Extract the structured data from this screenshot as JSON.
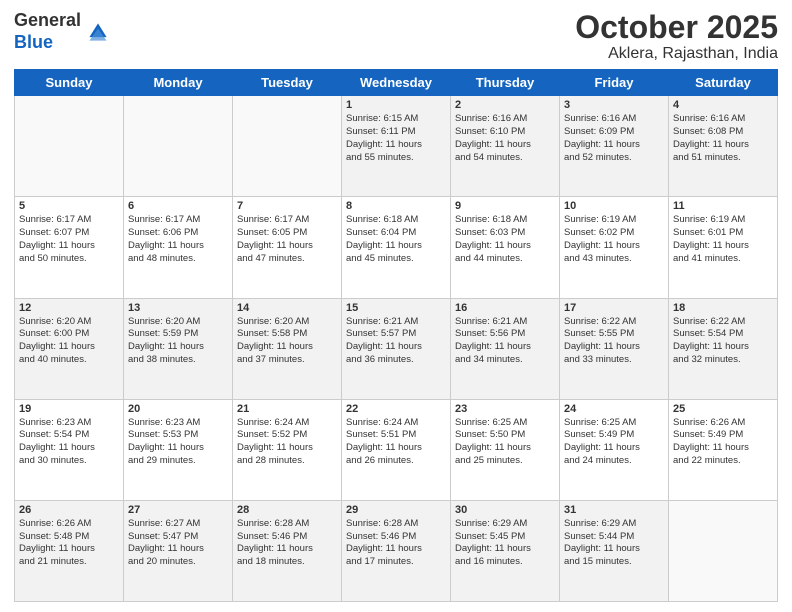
{
  "header": {
    "logo_general": "General",
    "logo_blue": "Blue",
    "month": "October 2025",
    "location": "Aklera, Rajasthan, India"
  },
  "days_of_week": [
    "Sunday",
    "Monday",
    "Tuesday",
    "Wednesday",
    "Thursday",
    "Friday",
    "Saturday"
  ],
  "weeks": [
    [
      {
        "day": "",
        "info": ""
      },
      {
        "day": "",
        "info": ""
      },
      {
        "day": "",
        "info": ""
      },
      {
        "day": "1",
        "info": "Sunrise: 6:15 AM\nSunset: 6:11 PM\nDaylight: 11 hours\nand 55 minutes."
      },
      {
        "day": "2",
        "info": "Sunrise: 6:16 AM\nSunset: 6:10 PM\nDaylight: 11 hours\nand 54 minutes."
      },
      {
        "day": "3",
        "info": "Sunrise: 6:16 AM\nSunset: 6:09 PM\nDaylight: 11 hours\nand 52 minutes."
      },
      {
        "day": "4",
        "info": "Sunrise: 6:16 AM\nSunset: 6:08 PM\nDaylight: 11 hours\nand 51 minutes."
      }
    ],
    [
      {
        "day": "5",
        "info": "Sunrise: 6:17 AM\nSunset: 6:07 PM\nDaylight: 11 hours\nand 50 minutes."
      },
      {
        "day": "6",
        "info": "Sunrise: 6:17 AM\nSunset: 6:06 PM\nDaylight: 11 hours\nand 48 minutes."
      },
      {
        "day": "7",
        "info": "Sunrise: 6:17 AM\nSunset: 6:05 PM\nDaylight: 11 hours\nand 47 minutes."
      },
      {
        "day": "8",
        "info": "Sunrise: 6:18 AM\nSunset: 6:04 PM\nDaylight: 11 hours\nand 45 minutes."
      },
      {
        "day": "9",
        "info": "Sunrise: 6:18 AM\nSunset: 6:03 PM\nDaylight: 11 hours\nand 44 minutes."
      },
      {
        "day": "10",
        "info": "Sunrise: 6:19 AM\nSunset: 6:02 PM\nDaylight: 11 hours\nand 43 minutes."
      },
      {
        "day": "11",
        "info": "Sunrise: 6:19 AM\nSunset: 6:01 PM\nDaylight: 11 hours\nand 41 minutes."
      }
    ],
    [
      {
        "day": "12",
        "info": "Sunrise: 6:20 AM\nSunset: 6:00 PM\nDaylight: 11 hours\nand 40 minutes."
      },
      {
        "day": "13",
        "info": "Sunrise: 6:20 AM\nSunset: 5:59 PM\nDaylight: 11 hours\nand 38 minutes."
      },
      {
        "day": "14",
        "info": "Sunrise: 6:20 AM\nSunset: 5:58 PM\nDaylight: 11 hours\nand 37 minutes."
      },
      {
        "day": "15",
        "info": "Sunrise: 6:21 AM\nSunset: 5:57 PM\nDaylight: 11 hours\nand 36 minutes."
      },
      {
        "day": "16",
        "info": "Sunrise: 6:21 AM\nSunset: 5:56 PM\nDaylight: 11 hours\nand 34 minutes."
      },
      {
        "day": "17",
        "info": "Sunrise: 6:22 AM\nSunset: 5:55 PM\nDaylight: 11 hours\nand 33 minutes."
      },
      {
        "day": "18",
        "info": "Sunrise: 6:22 AM\nSunset: 5:54 PM\nDaylight: 11 hours\nand 32 minutes."
      }
    ],
    [
      {
        "day": "19",
        "info": "Sunrise: 6:23 AM\nSunset: 5:54 PM\nDaylight: 11 hours\nand 30 minutes."
      },
      {
        "day": "20",
        "info": "Sunrise: 6:23 AM\nSunset: 5:53 PM\nDaylight: 11 hours\nand 29 minutes."
      },
      {
        "day": "21",
        "info": "Sunrise: 6:24 AM\nSunset: 5:52 PM\nDaylight: 11 hours\nand 28 minutes."
      },
      {
        "day": "22",
        "info": "Sunrise: 6:24 AM\nSunset: 5:51 PM\nDaylight: 11 hours\nand 26 minutes."
      },
      {
        "day": "23",
        "info": "Sunrise: 6:25 AM\nSunset: 5:50 PM\nDaylight: 11 hours\nand 25 minutes."
      },
      {
        "day": "24",
        "info": "Sunrise: 6:25 AM\nSunset: 5:49 PM\nDaylight: 11 hours\nand 24 minutes."
      },
      {
        "day": "25",
        "info": "Sunrise: 6:26 AM\nSunset: 5:49 PM\nDaylight: 11 hours\nand 22 minutes."
      }
    ],
    [
      {
        "day": "26",
        "info": "Sunrise: 6:26 AM\nSunset: 5:48 PM\nDaylight: 11 hours\nand 21 minutes."
      },
      {
        "day": "27",
        "info": "Sunrise: 6:27 AM\nSunset: 5:47 PM\nDaylight: 11 hours\nand 20 minutes."
      },
      {
        "day": "28",
        "info": "Sunrise: 6:28 AM\nSunset: 5:46 PM\nDaylight: 11 hours\nand 18 minutes."
      },
      {
        "day": "29",
        "info": "Sunrise: 6:28 AM\nSunset: 5:46 PM\nDaylight: 11 hours\nand 17 minutes."
      },
      {
        "day": "30",
        "info": "Sunrise: 6:29 AM\nSunset: 5:45 PM\nDaylight: 11 hours\nand 16 minutes."
      },
      {
        "day": "31",
        "info": "Sunrise: 6:29 AM\nSunset: 5:44 PM\nDaylight: 11 hours\nand 15 minutes."
      },
      {
        "day": "",
        "info": ""
      }
    ]
  ]
}
